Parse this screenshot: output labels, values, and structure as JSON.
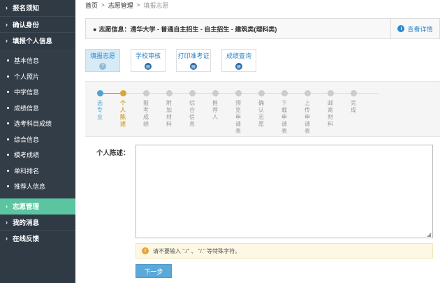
{
  "sidebar": {
    "top_items": [
      {
        "label": "报名须知"
      },
      {
        "label": "确认身份"
      },
      {
        "label": "填报个人信息"
      }
    ],
    "sub_items": [
      {
        "label": "基本信息"
      },
      {
        "label": "个人照片"
      },
      {
        "label": "中学信息"
      },
      {
        "label": "成绩信息"
      },
      {
        "label": "选考科目成绩"
      },
      {
        "label": "综合信息"
      },
      {
        "label": "模考成绩"
      },
      {
        "label": "单科排名"
      },
      {
        "label": "推荐人信息"
      }
    ],
    "bottom_items": [
      {
        "label": "志愿管理",
        "active": true
      },
      {
        "label": "我的消息"
      },
      {
        "label": "在线反馈"
      }
    ]
  },
  "breadcrumb": {
    "home": "首页",
    "section": "志愿管理",
    "current": "填报志愿"
  },
  "infobar": {
    "prefix": "●",
    "text": "志愿信息：清华大学 - 普通自主招生 - 自主招生 - 建筑类(理科类)",
    "detail_icon": "i",
    "detail_label": "查看详情"
  },
  "tabs": [
    {
      "label": "填报志愿",
      "icon": "?",
      "active": true
    },
    {
      "label": "学校审核",
      "icon": "▤"
    },
    {
      "label": "打印准考证",
      "icon": "▤"
    },
    {
      "label": "成绩查询",
      "icon": "▤"
    }
  ],
  "steps": [
    {
      "label": "选专业",
      "state": "done"
    },
    {
      "label": "个人陈述",
      "state": "current"
    },
    {
      "label": "报考成绩",
      "state": "todo"
    },
    {
      "label": "附加材料",
      "state": "todo"
    },
    {
      "label": "综合信息",
      "state": "todo"
    },
    {
      "label": "推荐人",
      "state": "todo"
    },
    {
      "label": "预览申请表",
      "state": "todo"
    },
    {
      "label": "确认志愿",
      "state": "todo"
    },
    {
      "label": "下载申请表",
      "state": "todo"
    },
    {
      "label": "上传申请表",
      "state": "todo"
    },
    {
      "label": "邮寄材料",
      "state": "todo"
    },
    {
      "label": "完成",
      "state": "todo"
    }
  ],
  "form": {
    "label": "个人陈述：",
    "value": "",
    "hint_icon": "!",
    "hint": "请不要输入 \"./\" 、 \"/.\" 等特殊字符。",
    "next_label": "下一步"
  },
  "colors": {
    "sidebar_bg": "#2f3a45",
    "active_green": "#5bc4a0",
    "accent_blue": "#2e87c8",
    "current_step": "#d4a93a"
  }
}
